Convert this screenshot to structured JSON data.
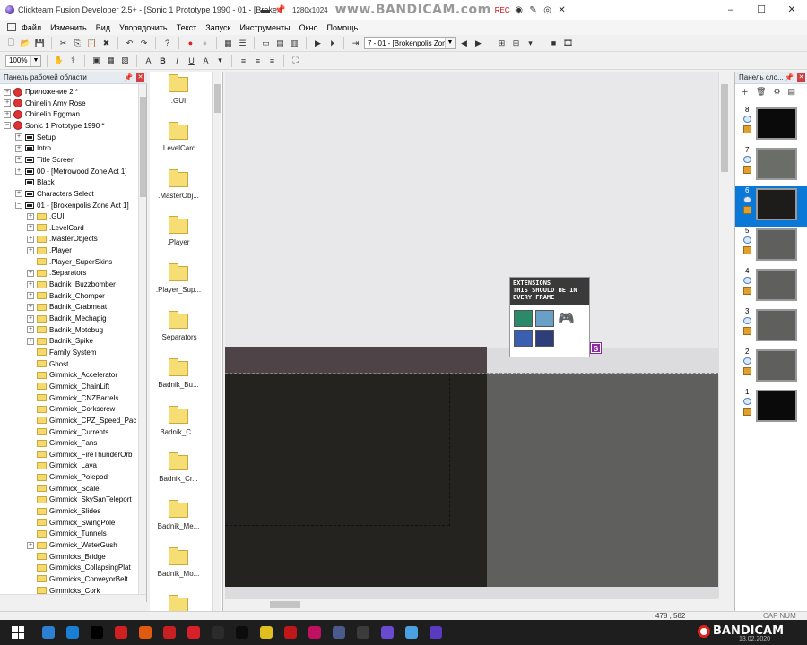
{
  "window": {
    "title": "Clickteam Fusion Developer 2.5+ - [Sonic 1 Prototype 1990 - 01 - [Broke",
    "controls": [
      "–",
      "☐",
      "✕"
    ]
  },
  "recorder": {
    "resolution": "1280x1024",
    "watermark": "www.BANDICAM.com",
    "rec_label": "REC"
  },
  "menu": [
    "Файл",
    "Изменить",
    "Вид",
    "Упорядочить",
    "Текст",
    "Запуск",
    "Инструменты",
    "Окно",
    "Помощь"
  ],
  "toolbar": {
    "frame_selector": "7 - 01 - [Brokenpolis Zon",
    "zoom": "100%"
  },
  "workspace": {
    "title": "Панель рабочей области",
    "items": [
      {
        "label": "Приложение 2 *",
        "type": "app",
        "level": 0,
        "exp": "+"
      },
      {
        "label": "Chinelin Amy Rose",
        "type": "app",
        "level": 0,
        "exp": "+"
      },
      {
        "label": "Chinelin Eggman",
        "type": "app",
        "level": 0,
        "exp": "+"
      },
      {
        "label": "Sonic 1 Prototype 1990 *",
        "type": "app",
        "level": 0,
        "exp": "−"
      },
      {
        "label": "Setup",
        "type": "frame",
        "level": 1,
        "exp": "+"
      },
      {
        "label": "Intro",
        "type": "frame",
        "level": 1,
        "exp": "+"
      },
      {
        "label": "Title Screen",
        "type": "frame",
        "level": 1,
        "exp": "+"
      },
      {
        "label": "00 - [Metrowood Zone Act 1]",
        "type": "frame",
        "level": 1,
        "exp": "+"
      },
      {
        "label": "Black",
        "type": "frame",
        "level": 1,
        "exp": ""
      },
      {
        "label": "Characters Select",
        "type": "frame",
        "level": 1,
        "exp": "+"
      },
      {
        "label": "01 - [Brokenpolis Zone Act 1]",
        "type": "frame",
        "level": 1,
        "exp": "−"
      },
      {
        "label": ".GUI",
        "type": "folder",
        "level": 2,
        "exp": "+"
      },
      {
        "label": ".LevelCard",
        "type": "folder",
        "level": 2,
        "exp": "+"
      },
      {
        "label": ".MasterObjects",
        "type": "folder",
        "level": 2,
        "exp": "+"
      },
      {
        "label": ".Player",
        "type": "folder",
        "level": 2,
        "exp": "+"
      },
      {
        "label": ".Player_SuperSkins",
        "type": "folder",
        "level": 2,
        "exp": ""
      },
      {
        "label": ".Separators",
        "type": "folder",
        "level": 2,
        "exp": "+"
      },
      {
        "label": "Badnik_Buzzbomber",
        "type": "folder",
        "level": 2,
        "exp": "+"
      },
      {
        "label": "Badnik_Chomper",
        "type": "folder",
        "level": 2,
        "exp": "+"
      },
      {
        "label": "Badnik_Crabmeat",
        "type": "folder",
        "level": 2,
        "exp": "+"
      },
      {
        "label": "Badnik_Mechapig",
        "type": "folder",
        "level": 2,
        "exp": "+"
      },
      {
        "label": "Badnik_Motobug",
        "type": "folder",
        "level": 2,
        "exp": "+"
      },
      {
        "label": "Badnik_Spike",
        "type": "folder",
        "level": 2,
        "exp": "+"
      },
      {
        "label": "Family System",
        "type": "folder",
        "level": 2,
        "exp": ""
      },
      {
        "label": "Ghost",
        "type": "folder",
        "level": 2,
        "exp": ""
      },
      {
        "label": "Gimmick_Accelerator",
        "type": "folder",
        "level": 2,
        "exp": ""
      },
      {
        "label": "Gimmick_ChainLift",
        "type": "folder",
        "level": 2,
        "exp": ""
      },
      {
        "label": "Gimmick_CNZBarrels",
        "type": "folder",
        "level": 2,
        "exp": ""
      },
      {
        "label": "Gimmick_Corkscrew",
        "type": "folder",
        "level": 2,
        "exp": ""
      },
      {
        "label": "Gimmick_CPZ_Speed_Pac",
        "type": "folder",
        "level": 2,
        "exp": ""
      },
      {
        "label": "Gimmick_Currents",
        "type": "folder",
        "level": 2,
        "exp": ""
      },
      {
        "label": "Gimmick_Fans",
        "type": "folder",
        "level": 2,
        "exp": ""
      },
      {
        "label": "Gimmick_FireThunderOrb",
        "type": "folder",
        "level": 2,
        "exp": ""
      },
      {
        "label": "Gimmick_Lava",
        "type": "folder",
        "level": 2,
        "exp": ""
      },
      {
        "label": "Gimmick_Polepod",
        "type": "folder",
        "level": 2,
        "exp": ""
      },
      {
        "label": "Gimmick_Scale",
        "type": "folder",
        "level": 2,
        "exp": ""
      },
      {
        "label": "Gimmick_SkySanTeleport",
        "type": "folder",
        "level": 2,
        "exp": ""
      },
      {
        "label": "Gimmick_Slides",
        "type": "folder",
        "level": 2,
        "exp": ""
      },
      {
        "label": "Gimmick_SwingPole",
        "type": "folder",
        "level": 2,
        "exp": ""
      },
      {
        "label": "Gimmick_Tunnels",
        "type": "folder",
        "level": 2,
        "exp": ""
      },
      {
        "label": "Gimmick_WaterGush",
        "type": "folder",
        "level": 2,
        "exp": "+"
      },
      {
        "label": "Gimmicks_Bridge",
        "type": "folder",
        "level": 2,
        "exp": ""
      },
      {
        "label": "Gimmicks_CollapsingPlat",
        "type": "folder",
        "level": 2,
        "exp": ""
      },
      {
        "label": "Gimmicks_ConveyorBelt",
        "type": "folder",
        "level": 2,
        "exp": ""
      },
      {
        "label": "Gimmicks_Cork",
        "type": "folder",
        "level": 2,
        "exp": ""
      }
    ]
  },
  "objects": [
    ".GUI",
    ".LevelCard",
    ".MasterObj...",
    ".Player",
    ".Player_Sup...",
    ".Separators",
    "Badnik_Bu...",
    "Badnik_C...",
    "Badnik_Cr...",
    "Badnik_Me...",
    "Badnik_Mo..."
  ],
  "editor": {
    "extensions_note": "EXTENSIONS\nTHIS SHOULD BE IN\nEVERY FRAME",
    "badge": "S"
  },
  "layers": {
    "title": "Панель сло...",
    "items": [
      {
        "num": "8",
        "thumb": "#0a0a0a"
      },
      {
        "num": "7",
        "thumb": "#6a6d68"
      },
      {
        "num": "6",
        "thumb": "#1e1c1a",
        "selected": true
      },
      {
        "num": "5",
        "thumb": "#5f605e"
      },
      {
        "num": "4",
        "thumb": "#5f605e"
      },
      {
        "num": "3",
        "thumb": "#5f605e"
      },
      {
        "num": "2",
        "thumb": "#5f605e"
      },
      {
        "num": "1",
        "thumb": "#0a0a0a"
      }
    ]
  },
  "status": {
    "coords": "478 , 582",
    "caps": "CAP NUM"
  },
  "taskbar": {
    "apps": [
      "#2d7fd1",
      "#1a7ed4",
      "#000000",
      "#d0201f",
      "#e05a10",
      "#c82020",
      "#d6202a",
      "#2b2b2b",
      "#0c0c0c",
      "#e0c020",
      "#c01818",
      "#c01060",
      "#4a5a8a",
      "#3b3b3b",
      "#6a4ad0",
      "#4aa0e0",
      "#5a3ac0"
    ],
    "tray_brand": "BANDICAM",
    "date": "13.02.2020"
  },
  "colors": {
    "editor_bg": "#e8e7ea",
    "dark_area": "#252320",
    "grey_area": "#5f605e",
    "selection": "#0a78d7"
  }
}
